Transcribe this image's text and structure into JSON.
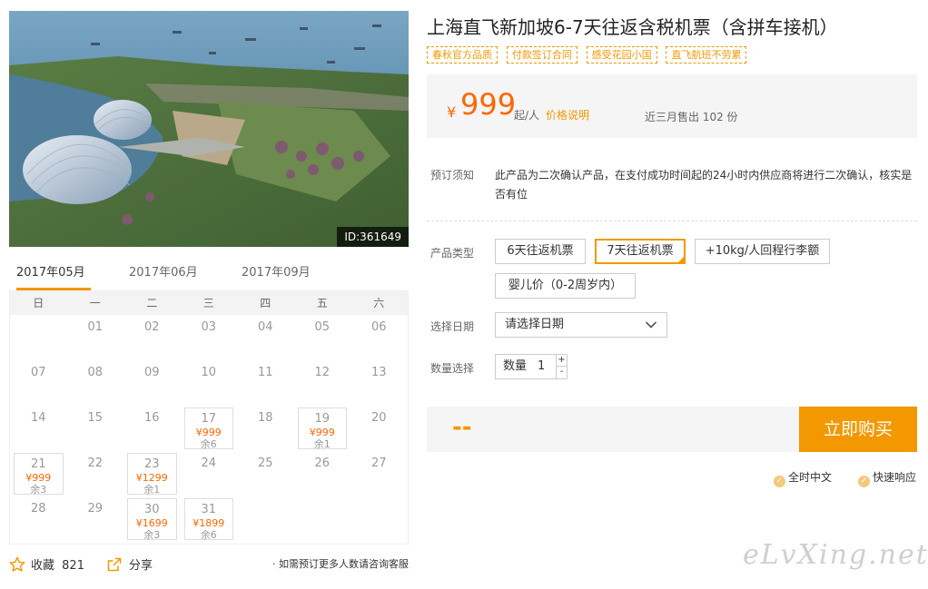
{
  "photo": {
    "id_label": "ID:361649"
  },
  "months": [
    "2017年05月",
    "2017年06月",
    "2017年09月"
  ],
  "weekdays": [
    "日",
    "一",
    "二",
    "三",
    "四",
    "五",
    "六"
  ],
  "calendar_weeks": [
    [
      {
        "day": ""
      },
      {
        "day": "01"
      },
      {
        "day": "02"
      },
      {
        "day": "03"
      },
      {
        "day": "04"
      },
      {
        "day": "05"
      },
      {
        "day": "06"
      }
    ],
    [
      {
        "day": "07"
      },
      {
        "day": "08"
      },
      {
        "day": "09"
      },
      {
        "day": "10"
      },
      {
        "day": "11"
      },
      {
        "day": "12"
      },
      {
        "day": "13"
      }
    ],
    [
      {
        "day": "14"
      },
      {
        "day": "15"
      },
      {
        "day": "16"
      },
      {
        "day": "17",
        "price": "¥999",
        "left": "余6"
      },
      {
        "day": "18"
      },
      {
        "day": "19",
        "price": "¥999",
        "left": "余1"
      },
      {
        "day": "20"
      }
    ],
    [
      {
        "day": "21",
        "price": "¥999",
        "left": "余3"
      },
      {
        "day": "22"
      },
      {
        "day": "23",
        "price": "¥1299",
        "left": "余1"
      },
      {
        "day": "24"
      },
      {
        "day": "25"
      },
      {
        "day": "26"
      },
      {
        "day": "27"
      }
    ],
    [
      {
        "day": "28"
      },
      {
        "day": "29"
      },
      {
        "day": "30",
        "price": "¥1699",
        "left": "余3"
      },
      {
        "day": "31",
        "price": "¥1899",
        "left": "余6"
      },
      {
        "day": ""
      },
      {
        "day": ""
      },
      {
        "day": ""
      }
    ]
  ],
  "share": {
    "fav_label": "收藏",
    "fav_count": "821",
    "share_label": "分享",
    "consult": "· 如需预订更多人数请咨询客服"
  },
  "product": {
    "title": "上海直飞新加坡6-7天往返含税机票（含拼车接机）",
    "tags": [
      "春秋官方品质",
      "付款签订合同",
      "感受花园小国",
      "直飞航班不劳累"
    ],
    "price_symbol": "¥",
    "price": "999",
    "price_unit": "起/人",
    "price_explain": "价格说明",
    "sold": "近三月售出 102 份"
  },
  "notice": {
    "label": "预订须知",
    "text": "此产品为二次确认产品，在支付成功时间起的24小时内供应商将进行二次确认，核实是否有位"
  },
  "options": {
    "type_label": "产品类型",
    "types": [
      "6天往返机票",
      "7天往返机票",
      "+10kg/人回程行李额",
      "婴儿价（0-2周岁内）"
    ],
    "selected_index": 1,
    "date_label": "选择日期",
    "date_placeholder": "请选择日期",
    "qty_label": "数量选择",
    "qty_text": "数量",
    "qty_value": "1",
    "plus": "+",
    "minus": "-"
  },
  "buy": {
    "total": "--",
    "button": "立即购买"
  },
  "guarantees": [
    "全时中文",
    "快速响应"
  ],
  "watermark": "eLvXing.net",
  "colors": {
    "accent": "#f39800",
    "price": "#ff6600"
  }
}
